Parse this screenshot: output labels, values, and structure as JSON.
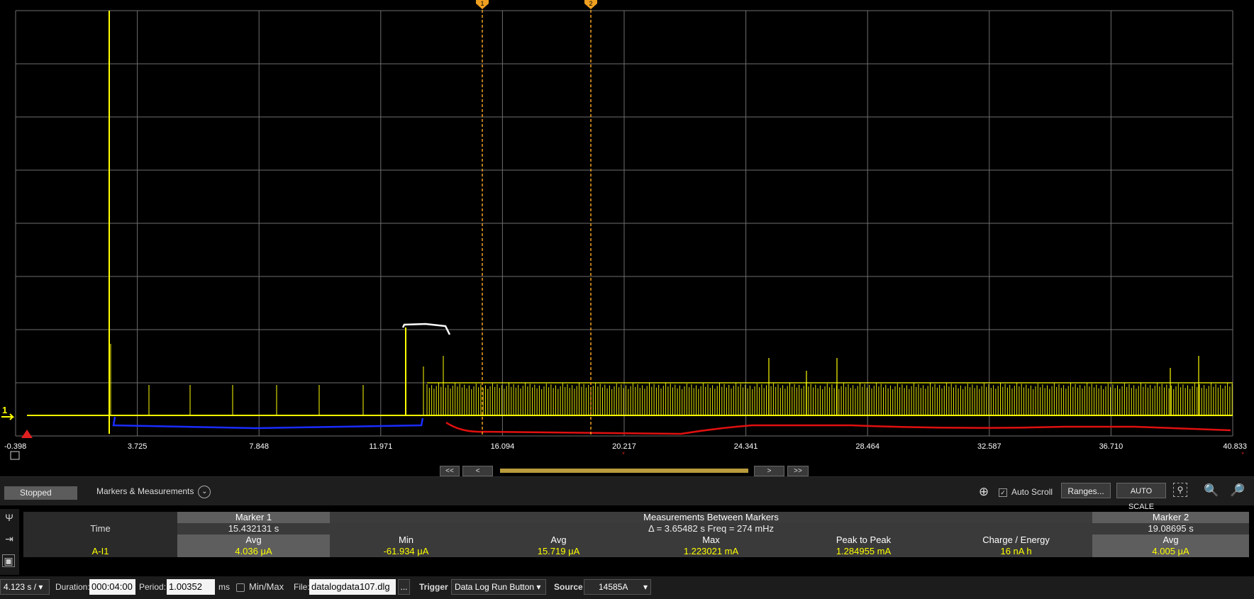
{
  "plot": {
    "x_ticks": [
      "-0.398",
      "3.725",
      "7.848",
      "11.971",
      "16.094",
      "20.217",
      "24.341",
      "28.464",
      "32.587",
      "36.710",
      "40.833"
    ],
    "marker1_label": "1",
    "marker2_label": "2",
    "channel_label": "1",
    "colors": {
      "trace": "#ffff00",
      "grid": "#6e6e6e",
      "marker": "#f0a020",
      "blue_stroke": "#1a2cff",
      "red_stroke": "#e01010"
    }
  },
  "nav": {
    "first": "<<",
    "prev": "<",
    "next": ">",
    "last": ">>"
  },
  "controls": {
    "status": "Stopped",
    "markers_measurements": "Markers & Measurements",
    "auto_scroll": "Auto Scroll",
    "ranges": "Ranges...",
    "auto_scale": "AUTO SCALE"
  },
  "measurements": {
    "marker1_header": "Marker 1",
    "between_header": "Measurements Between Markers",
    "marker2_header": "Marker 2",
    "time_label": "Time",
    "marker1_time": "15.432131 s",
    "between_time": "Δ = 3.65482 s   Freq = 274 mHz",
    "marker2_time": "19.08695 s",
    "sub_headers": {
      "m1": "Avg",
      "min": "Min",
      "avg": "Avg",
      "max": "Max",
      "p2p": "Peak to Peak",
      "charge": "Charge / Energy",
      "m2": "Avg"
    },
    "channel": "A-I1",
    "values": {
      "m1_avg": "4.036 μA",
      "min": "-61.934 μA",
      "avg": "15.719 μA",
      "max": "1.223021 mA",
      "p2p": "1.284955 mA",
      "charge": "16 nA h",
      "m2_avg": "4.005 μA"
    }
  },
  "bottom": {
    "timebase": "4.123 s /",
    "duration_label": "Duration:",
    "duration_value": "000:04:00",
    "period_label": "Period:",
    "period_value": "1.00352",
    "period_unit": "ms",
    "minmax_label": "Min/Max",
    "file_label": "File:",
    "file_value": "datalogdata107.dlg",
    "ellipsis": "...",
    "trigger_label": "Trigger",
    "trigger_value": "Data Log Run Button",
    "source_label": "Source",
    "source_value": "14585A"
  }
}
